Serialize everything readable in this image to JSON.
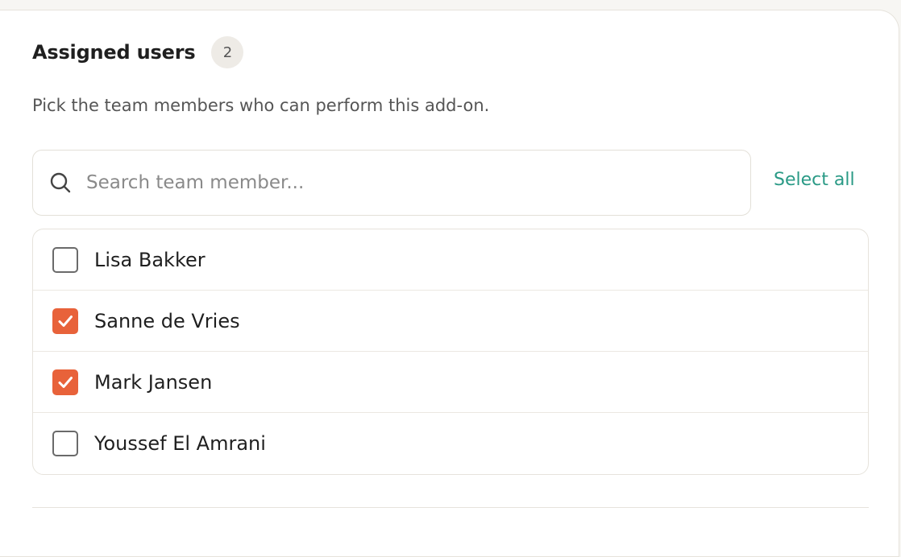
{
  "section": {
    "title": "Assigned users",
    "count": "2",
    "subtitle": "Pick the team members who can perform this add-on."
  },
  "search": {
    "placeholder": "Search team member...",
    "icon": "search-icon"
  },
  "select_all_label": "Select all",
  "members": [
    {
      "name": "Lisa Bakker",
      "checked": false
    },
    {
      "name": "Sanne de Vries",
      "checked": true
    },
    {
      "name": "Mark Jansen",
      "checked": true
    },
    {
      "name": "Youssef El Amrani",
      "checked": false
    }
  ],
  "colors": {
    "accent": "#e8623a",
    "link": "#2a9a86",
    "text": "#1f1f1f",
    "muted": "#555555"
  }
}
